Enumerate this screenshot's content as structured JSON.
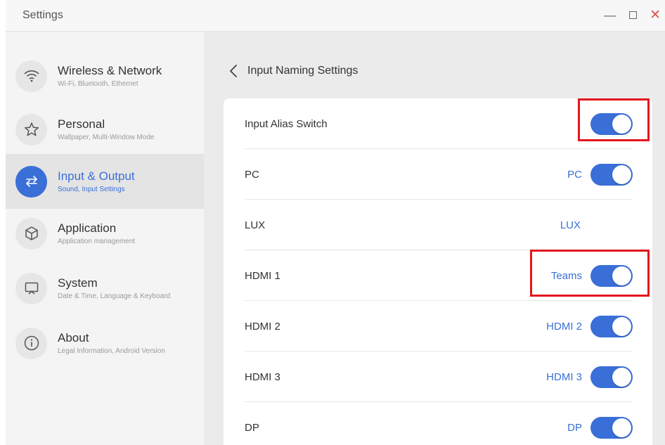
{
  "window": {
    "title": "Settings",
    "minimize_glyph": "—",
    "close_glyph": "✕"
  },
  "sidebar": {
    "items": [
      {
        "label": "Wireless & Network",
        "sub": "Wi-Fi, Bluetooth, Ethernet",
        "icon": "wifi-icon",
        "active": false
      },
      {
        "label": "Personal",
        "sub": "Wallpaper, Multi-Window Mode",
        "icon": "star-icon",
        "active": false
      },
      {
        "label": "Input & Output",
        "sub": "Sound, Input Settings",
        "icon": "swap-arrows-icon",
        "active": true
      },
      {
        "label": "Application",
        "sub": "Application management",
        "icon": "cube-icon",
        "active": false
      },
      {
        "label": "System",
        "sub": "Date & Time, Language & Keyboard",
        "icon": "monitor-icon",
        "active": false
      },
      {
        "label": "About",
        "sub": "Legal Information, Android Version",
        "icon": "info-icon",
        "active": false
      }
    ]
  },
  "main": {
    "page_title": "Input Naming Settings",
    "rows": [
      {
        "label": "Input Alias Switch",
        "alias": "",
        "toggle": true
      },
      {
        "label": "PC",
        "alias": "PC",
        "toggle": true
      },
      {
        "label": "LUX",
        "alias": "LUX",
        "toggle": false
      },
      {
        "label": "HDMI 1",
        "alias": "Teams",
        "toggle": true
      },
      {
        "label": "HDMI 2",
        "alias": "HDMI 2",
        "toggle": true
      },
      {
        "label": "HDMI 3",
        "alias": "HDMI 3",
        "toggle": true
      },
      {
        "label": "DP",
        "alias": "DP",
        "toggle": true
      }
    ]
  },
  "colors": {
    "accent": "#3a6fd8",
    "highlight_box": "#e3161c",
    "sidebar_bg": "#f4f4f4",
    "main_bg": "#ebebeb"
  }
}
